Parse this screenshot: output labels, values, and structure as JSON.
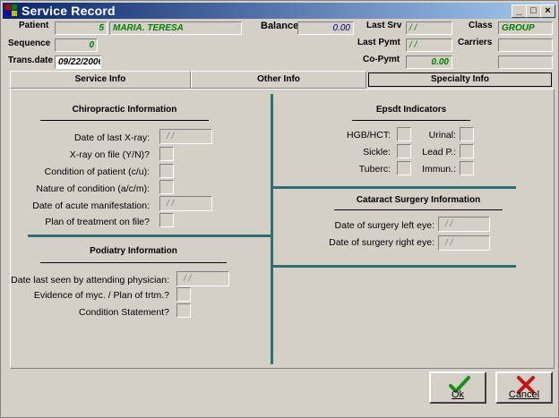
{
  "window": {
    "title": "Service Record"
  },
  "titlebar_buttons": {
    "minimize": "_",
    "maximize": "□",
    "close": "×"
  },
  "header": {
    "patient_label": "Patient",
    "patient_id": "5",
    "patient_name": "MARIA. TERESA",
    "balance_label": "Balance",
    "balance_value": "0.00",
    "last_srv_label": "Last Srv",
    "last_srv_value": "/ /",
    "class_label": "Class",
    "class_value": "GROUP",
    "sequence_label": "Sequence",
    "sequence_value": "0",
    "last_pymt_label": "Last Pymt",
    "last_pymt_value": "/ /",
    "carriers_label": "Carriers",
    "trans_date_label": "Trans.date",
    "trans_date_value": "09/22/2006",
    "copymt_label": "Co-Pymt",
    "copymt_value": "0.00"
  },
  "tabs": [
    {
      "label": "Service Info"
    },
    {
      "label": "Other Info"
    },
    {
      "label": "Specialty Info",
      "active": true
    }
  ],
  "chiropractic": {
    "title": "Chiropractic Information",
    "fields": [
      {
        "label": "Date of last X-ray:",
        "value": "/ /"
      },
      {
        "label": "X-ray on file (Y/N)?"
      },
      {
        "label": "Condition of patient (c/u):"
      },
      {
        "label": "Nature of condition (a/c/m):"
      },
      {
        "label": "Date of acute manifestation:",
        "value": "/ /"
      },
      {
        "label": "Plan of treatment on file?"
      }
    ]
  },
  "podiatry": {
    "title": "Podiatry Information",
    "fields": [
      {
        "label": "Date last seen by attending physician:",
        "value": "/ /"
      },
      {
        "label": "Evidence of myc. / Plan of trtm.?"
      },
      {
        "label": "Condition Statement?"
      }
    ]
  },
  "epsdt": {
    "title": "Epsdt Indicators",
    "left": [
      {
        "label": "HGB/HCT:"
      },
      {
        "label": "Sickle:"
      },
      {
        "label": "Tuberc:"
      }
    ],
    "right": [
      {
        "label": "Urinal:"
      },
      {
        "label": "Lead P.:"
      },
      {
        "label": "Immun.:"
      }
    ]
  },
  "cataract": {
    "title": "Cataract Surgery Information",
    "fields": [
      {
        "label": "Date of surgery left eye:",
        "value": "/ /"
      },
      {
        "label": "Date of surgery right eye:",
        "value": "/ /"
      }
    ]
  },
  "buttons": {
    "ok": "Ok",
    "cancel": "Cancel"
  },
  "colors": {
    "title_start": "#0a246a",
    "title_end": "#a6caf0",
    "divider": "#2f6f6f",
    "field_text": "#008000"
  }
}
